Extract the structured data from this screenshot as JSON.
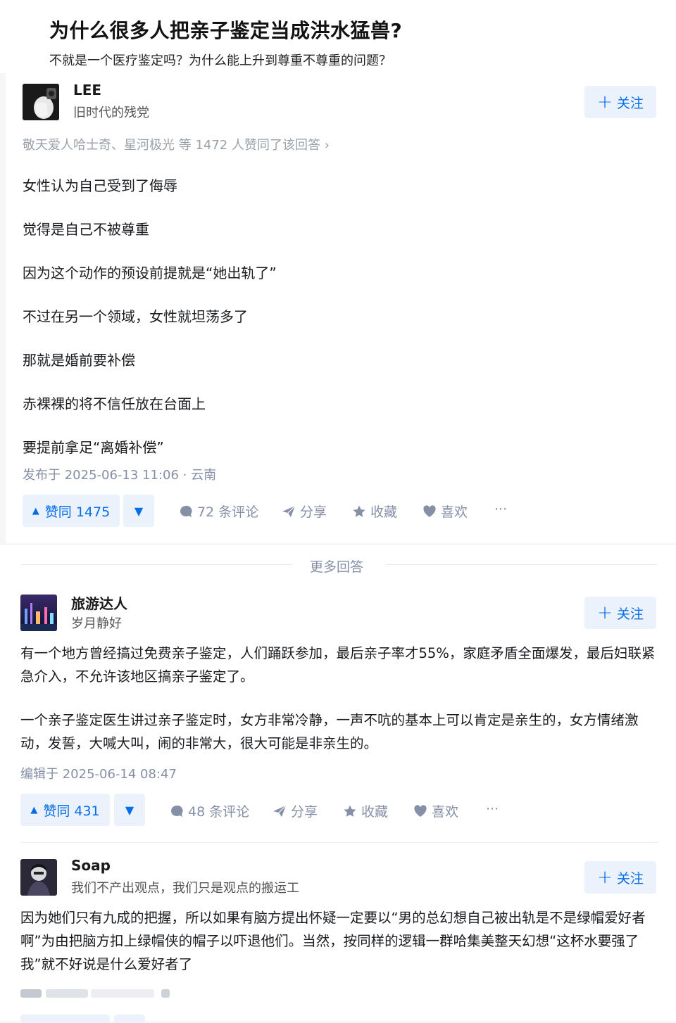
{
  "question": {
    "title": "为什么很多人把亲子鉴定当成洪水猛兽?",
    "desc": "不就是一个医疗鉴定吗？为什么能上升到尊重不尊重的问题？"
  },
  "follow_label": "关注",
  "answers": [
    {
      "author": "LEE",
      "bio": "旧时代的残党",
      "likers": "敬天爱人哈士奇、星河极光 等 1472 人赞同了该回答 ›",
      "paragraphs": [
        "女性认为自己受到了侮辱",
        "觉得是自己不被尊重",
        "因为这个动作的预设前提就是“她出轨了”",
        "不过在另一个领域，女性就坦荡多了",
        "那就是婚前要补偿",
        "赤裸裸的将不信任放在台面上",
        "要提前拿足“离婚补偿”"
      ],
      "meta": "发布于 2025-06-13 11:06 · 云南",
      "vote": "赞同 1475",
      "comments": "72 条评论",
      "share": "分享",
      "collect": "收藏",
      "like": "喜欢",
      "more": "···"
    },
    {
      "author": "旅游达人",
      "bio": "岁月静好",
      "paragraphs": [
        "有一个地方曾经搞过免费亲子鉴定，人们踊跃参加，最后亲子率才55%，家庭矛盾全面爆发，最后妇联紧急介入，不允许该地区搞亲子鉴定了。",
        "一个亲子鉴定医生讲过亲子鉴定时，女方非常冷静，一声不吭的基本上可以肯定是亲生的，女方情绪激动，发誓，大喊大叫，闹的非常大，很大可能是非亲生的。"
      ],
      "meta": "编辑于 2025-06-14 08:47",
      "vote": "赞同 431",
      "comments": "48 条评论",
      "share": "分享",
      "collect": "收藏",
      "like": "喜欢",
      "more": "···"
    },
    {
      "author": "Soap",
      "bio": "我们不产出观点，我们只是观点的搬运工",
      "paragraphs": [
        "因为她们只有九成的把握，所以如果有脑方提出怀疑一定要以“男的总幻想自己被出轨是不是绿帽爱好者啊”为由把脑方扣上绿帽侠的帽子以吓退他们。当然，按同样的逻辑一群哈集美整天幻想“这杯水要强了我”就不好说是什么爱好者了"
      ]
    }
  ],
  "more_answers": "更多回答",
  "colors": {
    "accent": "#056de8",
    "accent_bg": "#ebf2fb",
    "meta": "#8590a6"
  }
}
